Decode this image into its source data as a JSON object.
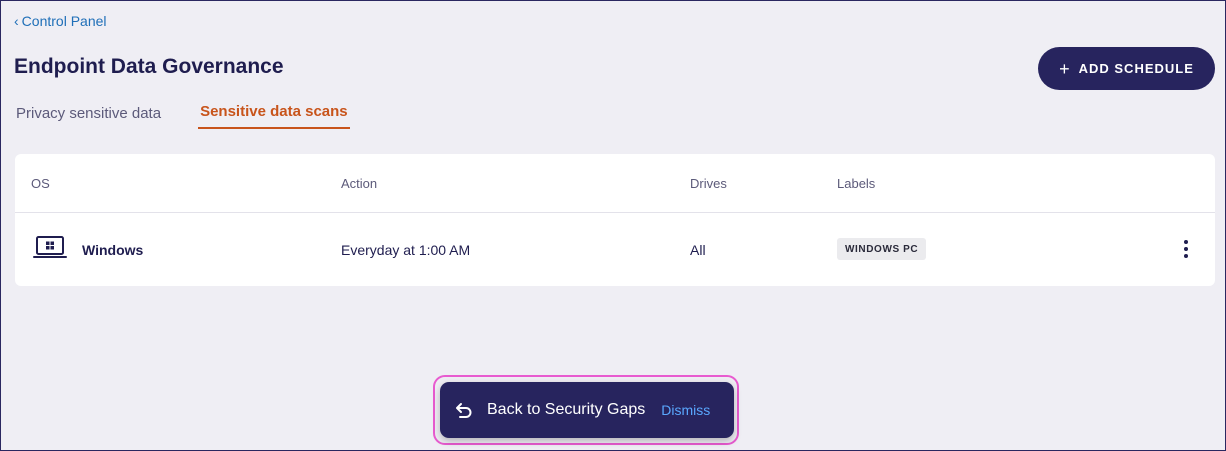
{
  "breadcrumb": {
    "chevron": "‹",
    "label": "Control Panel"
  },
  "header": {
    "title": "Endpoint Data Governance",
    "add_button": "ADD SCHEDULE",
    "add_icon": "+"
  },
  "tabs": [
    {
      "label": "Privacy sensitive data",
      "active": false
    },
    {
      "label": "Sensitive data scans",
      "active": true
    }
  ],
  "table": {
    "columns": [
      "OS",
      "Action",
      "Drives",
      "Labels"
    ],
    "rows": [
      {
        "os": "Windows",
        "os_icon": "laptop-windows-icon",
        "action": "Everyday at 1:00 AM",
        "drives": "All",
        "label": "WINDOWS PC"
      }
    ]
  },
  "toast": {
    "message": "Back to Security Gaps",
    "dismiss": "Dismiss",
    "icon": "undo-arrow-icon"
  },
  "colors": {
    "primary": "#27245e",
    "accent_tab": "#c8541b",
    "link": "#1f6fb8",
    "highlight_outline": "#e85bd0",
    "dismiss_link": "#5aa8ff"
  }
}
